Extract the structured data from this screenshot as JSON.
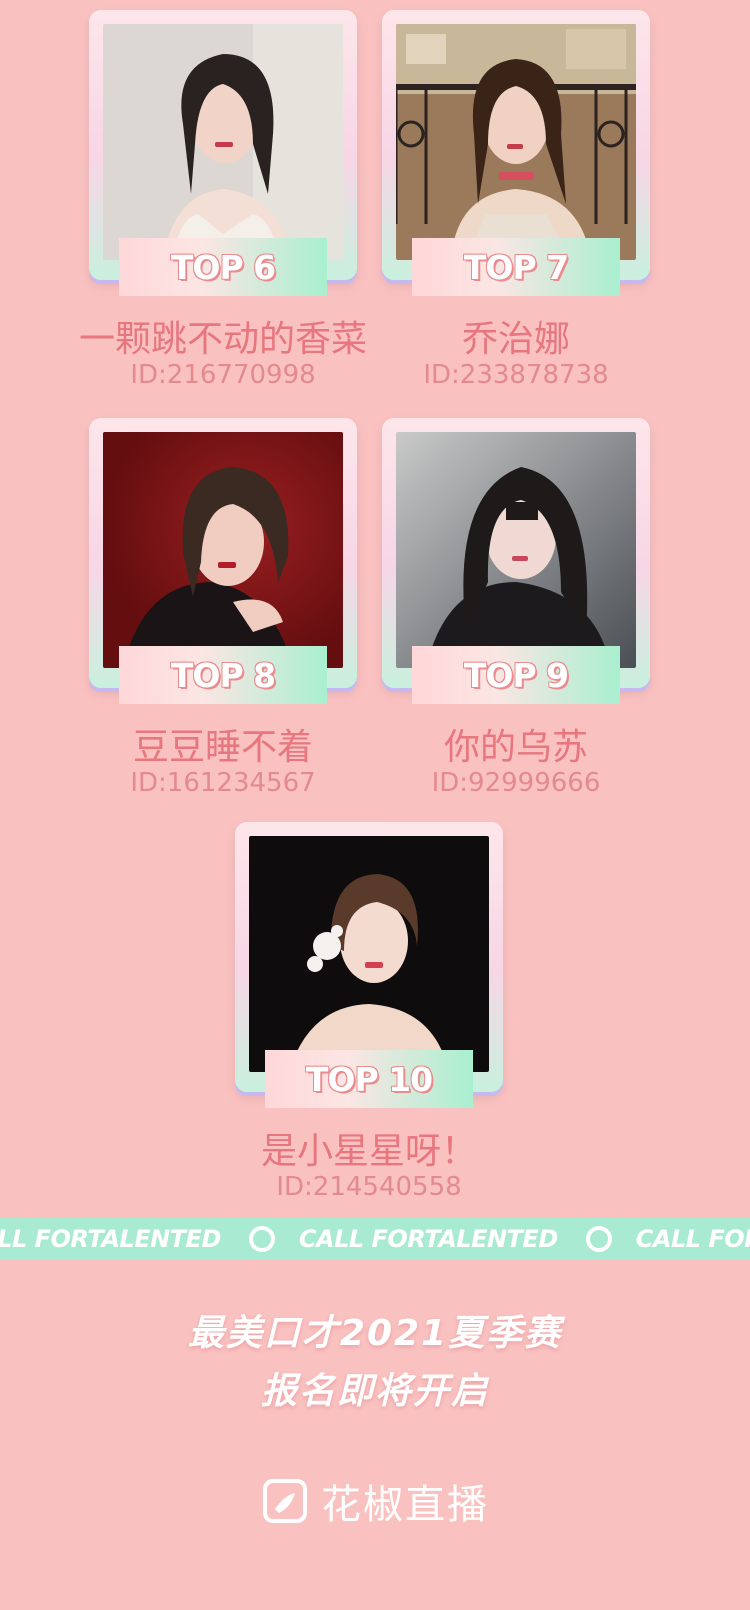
{
  "cards": [
    {
      "rank": "TOP 6",
      "name": "一颗跳不动的香菜",
      "id": "ID:216770998"
    },
    {
      "rank": "TOP 7",
      "name": "乔治娜",
      "id": "ID:233878738"
    },
    {
      "rank": "TOP 8",
      "name": "豆豆睡不着",
      "id": "ID:161234567"
    },
    {
      "rank": "TOP 9",
      "name": "你的乌苏",
      "id": "ID:92999666"
    },
    {
      "rank": "TOP 10",
      "name": "是小星星呀！",
      "id": "ID:214540558"
    }
  ],
  "ticker": {
    "text": "CALL FORTALENTED"
  },
  "promo": {
    "line1": "最美口才2021夏季赛",
    "line2": "报名即将开启"
  },
  "brand": {
    "name": "花椒直播"
  },
  "colors": {
    "background": "#f9c2c0",
    "ticker": "#a8ead2",
    "name_text": "#e7767e",
    "badge_outline": "#e98b8f"
  }
}
